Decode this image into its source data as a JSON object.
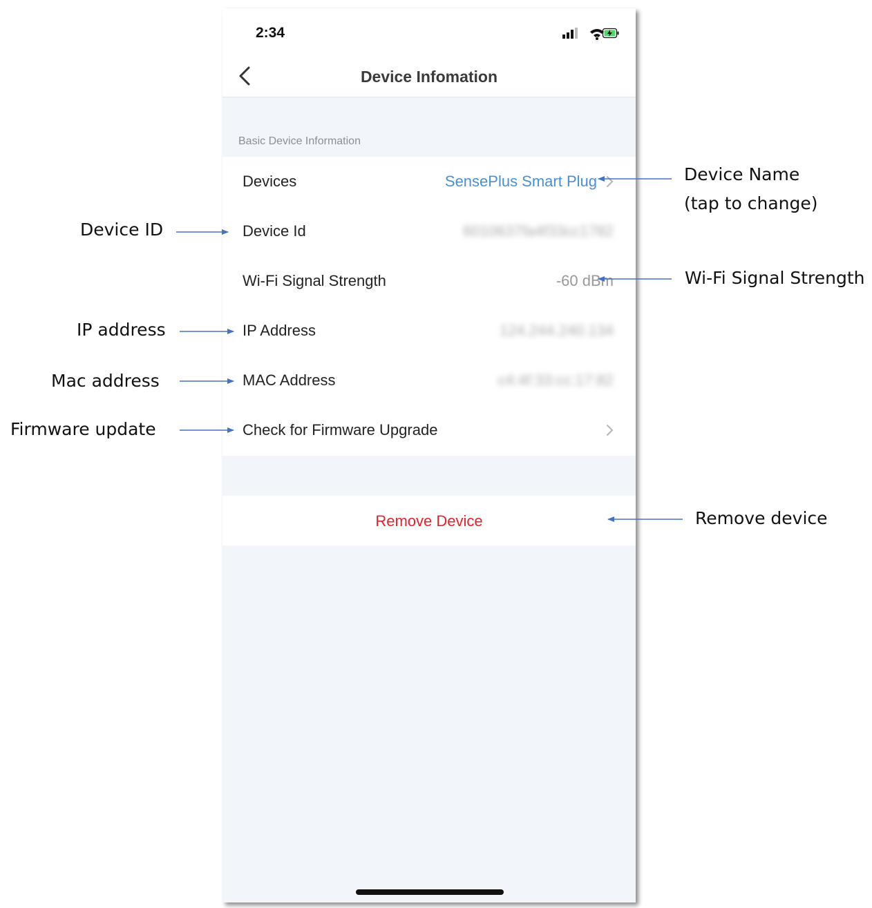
{
  "status_bar": {
    "time": "2:34"
  },
  "nav": {
    "title": "Device Infomation"
  },
  "section": {
    "header": "Basic Device Information"
  },
  "rows": [
    {
      "label": "Devices",
      "value": "SensePlus Smart Plug"
    },
    {
      "label": "Device Id",
      "value": "6010637fa4f33cc1782"
    },
    {
      "label": "Wi-Fi Signal Strength",
      "value": "-60 dBm"
    },
    {
      "label": "IP Address",
      "value": "124.244.240.134"
    },
    {
      "label": "MAC Address",
      "value": "c4:4f:33:cc:17:82"
    },
    {
      "label": "Check for Firmware Upgrade",
      "value": ""
    }
  ],
  "remove": {
    "label": "Remove Device"
  },
  "annotations": {
    "device_name_line1": "Device Name",
    "device_name_line2": "(tap to change)",
    "device_id": "Device ID",
    "wifi": "Wi-Fi Signal Strength",
    "ip": "IP address",
    "mac": "Mac address",
    "firmware": "Firmware update",
    "remove": "Remove device"
  },
  "colors": {
    "link": "#4a8fd1",
    "destructive": "#e8202a",
    "arrow": "#4472c4",
    "background": "#f2f6fa"
  }
}
